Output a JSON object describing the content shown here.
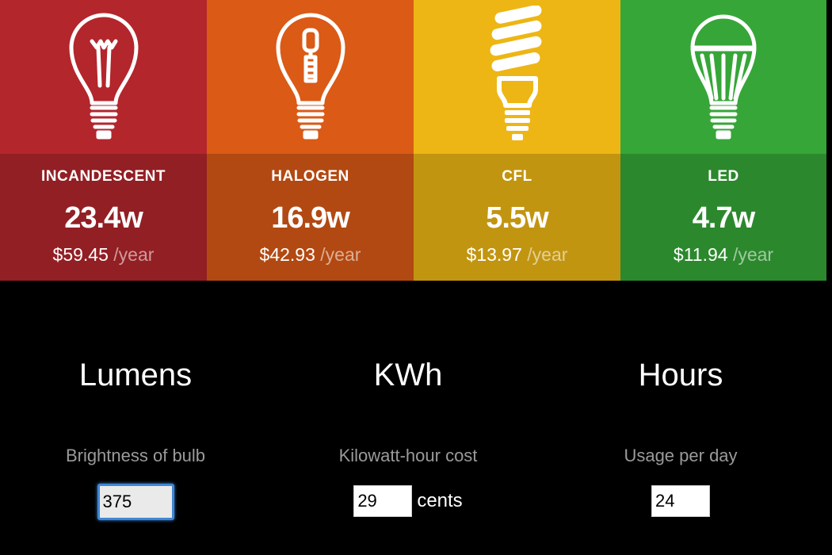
{
  "bulbs": [
    {
      "type": "INCANDESCENT",
      "watts": "23.4w",
      "cost": "$59.45",
      "per": "/year",
      "color": "#b3262c",
      "icon": "incandescent-bulb-icon"
    },
    {
      "type": "HALOGEN",
      "watts": "16.9w",
      "cost": "$42.93",
      "per": "/year",
      "color": "#da5a16",
      "icon": "halogen-bulb-icon"
    },
    {
      "type": "CFL",
      "watts": "5.5w",
      "cost": "$13.97",
      "per": "/year",
      "color": "#edb615",
      "icon": "cfl-bulb-icon"
    },
    {
      "type": "LED",
      "watts": "4.7w",
      "cost": "$11.94",
      "per": "/year",
      "color": "#36a638",
      "icon": "led-bulb-icon"
    }
  ],
  "controls": {
    "lumens": {
      "title": "Lumens",
      "desc": "Brightness of bulb",
      "value": "375"
    },
    "kwh": {
      "title": "KWh",
      "desc": "Kilowatt-hour cost",
      "value": "29",
      "unit": "cents"
    },
    "hours": {
      "title": "Hours",
      "desc": "Usage per day",
      "value": "24"
    }
  }
}
